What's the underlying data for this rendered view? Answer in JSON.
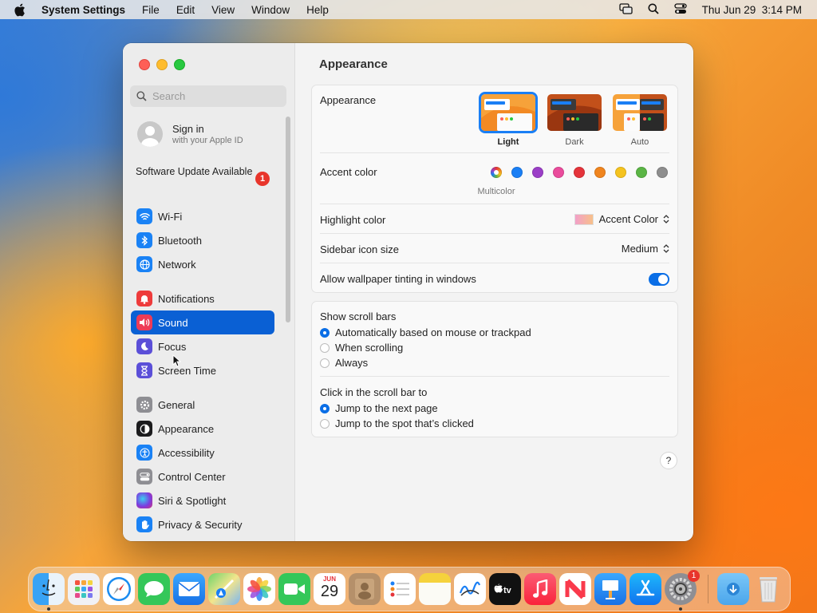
{
  "menubar": {
    "app_name": "System Settings",
    "menus": [
      "File",
      "Edit",
      "View",
      "Window",
      "Help"
    ],
    "clock": "Thu Jun 29  3:14 PM"
  },
  "sidebar": {
    "search_placeholder": "Search",
    "signin_title": "Sign in",
    "signin_subtitle": "with your Apple ID",
    "update_text": "Software Update Available",
    "update_badge": "1",
    "items": [
      {
        "label": "Wi-Fi",
        "icon": "wifi-icon",
        "color": "#1a82f5"
      },
      {
        "label": "Bluetooth",
        "icon": "bluetooth-icon",
        "color": "#1a82f5"
      },
      {
        "label": "Network",
        "icon": "globe-icon",
        "color": "#1a82f5"
      },
      {
        "label": "Notifications",
        "icon": "bell-icon",
        "color": "#ee3b3b"
      },
      {
        "label": "Sound",
        "icon": "speaker-icon",
        "color": "#ee3b57",
        "selected": true
      },
      {
        "label": "Focus",
        "icon": "moon-icon",
        "color": "#5b4fd8"
      },
      {
        "label": "Screen Time",
        "icon": "hourglass-icon",
        "color": "#5b4fd8"
      },
      {
        "label": "General",
        "icon": "gear-icon",
        "color": "#8e8e93"
      },
      {
        "label": "Appearance",
        "icon": "appearance-icon",
        "color": "#1c1c1e"
      },
      {
        "label": "Accessibility",
        "icon": "accessibility-icon",
        "color": "#1a82f5"
      },
      {
        "label": "Control Center",
        "icon": "control-center-icon",
        "color": "#8e8e93"
      },
      {
        "label": "Siri & Spotlight",
        "icon": "siri-icon",
        "color": "#9d34c9"
      },
      {
        "label": "Privacy & Security",
        "icon": "hand-icon",
        "color": "#1a82f5"
      }
    ]
  },
  "content": {
    "title": "Appearance",
    "appearance_label": "Appearance",
    "modes": [
      {
        "label": "Light",
        "selected": true
      },
      {
        "label": "Dark",
        "selected": false
      },
      {
        "label": "Auto",
        "selected": false
      }
    ],
    "accent_label": "Accent color",
    "accent_colors": [
      "multicolor",
      "#1a7ff5",
      "#9b3fc7",
      "#ea4c9c",
      "#e5343b",
      "#f0851e",
      "#f5c31f",
      "#5bb545",
      "#8e8e8e"
    ],
    "accent_caption": "Multicolor",
    "highlight_label": "Highlight color",
    "highlight_value": "Accent Color",
    "sidebar_icon_label": "Sidebar icon size",
    "sidebar_icon_value": "Medium",
    "tinting_label": "Allow wallpaper tinting in windows",
    "tinting_on": true,
    "scrollbars_label": "Show scroll bars",
    "scrollbar_options": [
      {
        "label": "Automatically based on mouse or trackpad",
        "selected": true
      },
      {
        "label": "When scrolling",
        "selected": false
      },
      {
        "label": "Always",
        "selected": false
      }
    ],
    "click_label": "Click in the scroll bar to",
    "click_options": [
      {
        "label": "Jump to the next page",
        "selected": true
      },
      {
        "label": "Jump to the spot that’s clicked",
        "selected": false
      }
    ],
    "help": "?"
  },
  "dock": {
    "items": [
      "finder",
      "launchpad",
      "safari",
      "messages",
      "mail",
      "maps",
      "photos",
      "facetime",
      "calendar",
      "contacts",
      "reminders",
      "notes",
      "freeform",
      "tv",
      "music",
      "news",
      "keynote",
      "app-store",
      "system-settings",
      "downloads",
      "trash"
    ],
    "calendar_month": "JUN",
    "calendar_day": "29",
    "settings_badge": "1"
  }
}
